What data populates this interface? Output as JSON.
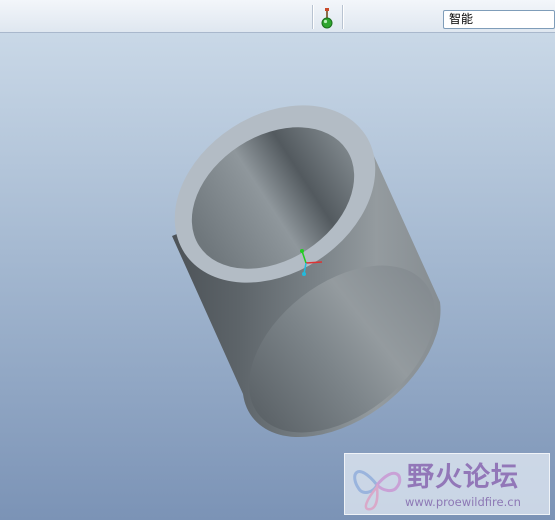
{
  "toolbar": {
    "filter_value": "智能",
    "display_toggle_icon": "datum-display-toggle-icon"
  },
  "watermark": {
    "title": "野火论坛",
    "url": "www.proewildfire.cn",
    "logo_icon": "butterfly-logo-icon"
  },
  "colors": {
    "toolbar_bg": "#e6edf5",
    "viewport_top": "#c9d8e7",
    "viewport_bottom": "#7b93b6",
    "model_gray": "#7e868c",
    "watermark_text": "#9277b8"
  }
}
